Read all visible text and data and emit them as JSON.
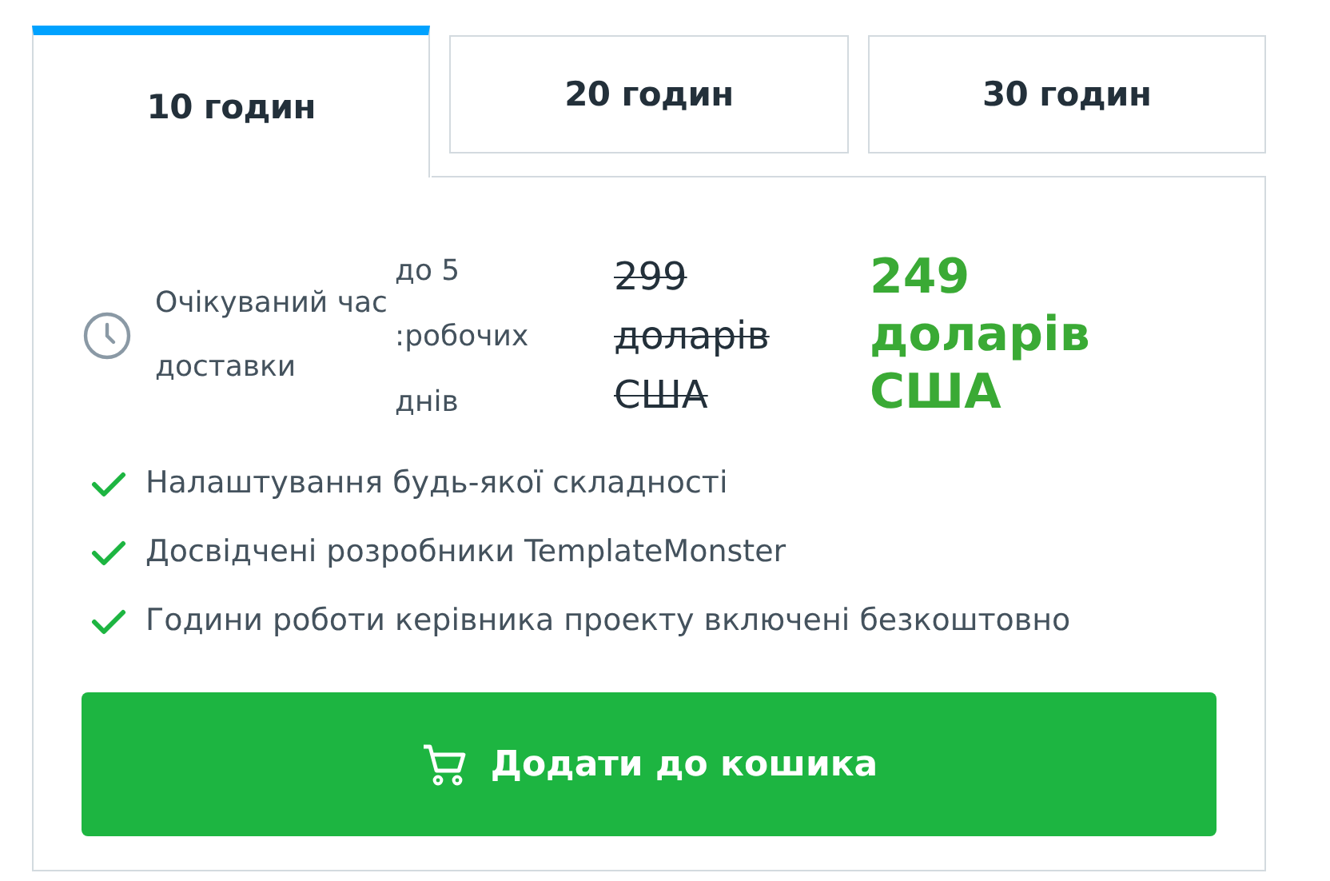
{
  "tabs": [
    {
      "label": "10 годин",
      "selected": true
    },
    {
      "label": "20 годин",
      "selected": false
    },
    {
      "label": "30 годин",
      "selected": false
    }
  ],
  "delivery": {
    "label": "Очікуваний час доставки",
    "value": "до 5 :робочих днів"
  },
  "price": {
    "old": "299 доларів США",
    "old_struck": true,
    "new": "249 доларів США"
  },
  "features": [
    "Налаштування будь-якої складності",
    "Досвідчені розробники TemplateMonster",
    "Години роботи керівника проекту включені безкоштовно"
  ],
  "button": {
    "label": "Додати до кошика"
  }
}
